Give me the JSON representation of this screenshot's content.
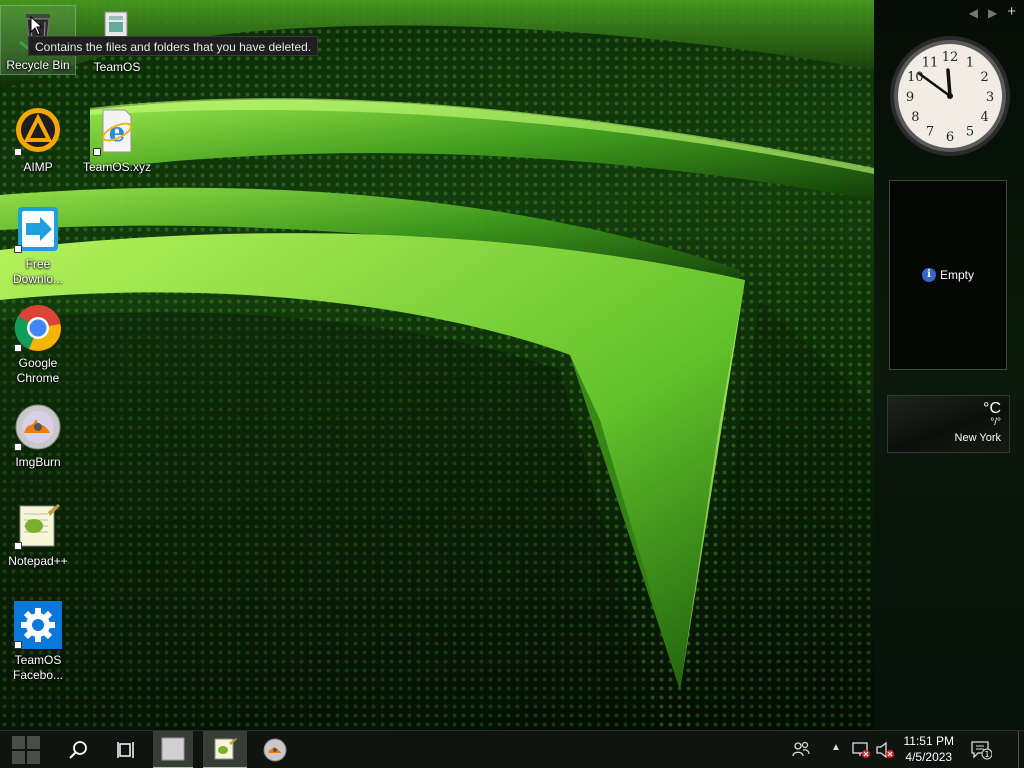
{
  "desktop": {
    "icons": [
      {
        "label": "Recycle Bin",
        "icon": "recycle-bin-icon"
      },
      {
        "label": "TeamOS",
        "icon": "folder-icon"
      },
      {
        "label": "AIMP",
        "icon": "aimp-icon"
      },
      {
        "label": "TeamOS.xyz",
        "icon": "internet-explorer-icon"
      },
      {
        "label": "Free Downlo...",
        "icon": "free-download-manager-icon"
      },
      {
        "label": "Google Chrome",
        "icon": "chrome-icon"
      },
      {
        "label": "ImgBurn",
        "icon": "imgburn-icon"
      },
      {
        "label": "Notepad++",
        "icon": "notepad-plus-plus-icon"
      },
      {
        "label": "TeamOS Facebo...",
        "icon": "settings-gear-icon"
      }
    ],
    "tooltip": "Contains the files and folders that you have deleted."
  },
  "sidebar": {
    "controls": {
      "prev": "◀",
      "next": "▶",
      "add": "+"
    },
    "clock": {
      "time": "11:51",
      "numerals": [
        "12",
        "1",
        "2",
        "3",
        "4",
        "5",
        "6",
        "7",
        "8",
        "9",
        "10",
        "11"
      ]
    },
    "slideshow": {
      "text": "Empty",
      "info": "i"
    },
    "weather": {
      "unit": "°C",
      "temp": "°/°",
      "city": "New York"
    }
  },
  "taskbar": {
    "start_icon": "windows-logo-icon",
    "search_icon": "search-icon",
    "task_view_icon": "task-view-icon",
    "pinned": [
      {
        "name": "app-window",
        "icon": "window-icon",
        "active": true
      },
      {
        "name": "notepad-plus-plus",
        "icon": "notepad-plus-plus-icon",
        "active": true
      },
      {
        "name": "imgburn",
        "icon": "imgburn-icon",
        "active": false
      }
    ],
    "tray": {
      "time": "11:51 PM",
      "date": "4/5/2023",
      "notification_count": "1",
      "icons": [
        "people-icon",
        "chevron-up-icon",
        "network-disconnected-icon",
        "volume-muted-icon",
        "action-center-icon"
      ]
    }
  },
  "colors": {
    "accent": "#7dd63a",
    "taskbar": "#101410",
    "sidebar": "#0a1a0a"
  }
}
